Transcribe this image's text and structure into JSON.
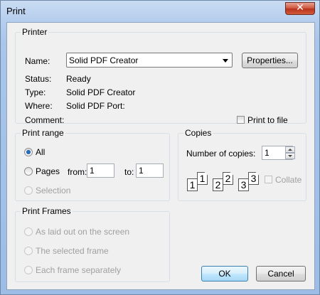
{
  "window": {
    "title": "Print",
    "close_glyph": "✕"
  },
  "printer": {
    "group_label": "Printer",
    "name_label": "Name:",
    "name_value": "Solid PDF Creator",
    "properties_button": "Properties...",
    "status_label": "Status:",
    "status_value": "Ready",
    "type_label": "Type:",
    "type_value": "Solid PDF Creator",
    "where_label": "Where:",
    "where_value": "Solid PDF Port:",
    "comment_label": "Comment:",
    "comment_value": "",
    "print_to_file": {
      "label": "Print to file",
      "checked": false
    }
  },
  "print_range": {
    "group_label": "Print range",
    "all_label": "All",
    "all_selected": true,
    "pages_label": "Pages",
    "from_label": "from:",
    "from_value": "1",
    "to_label": "to:",
    "to_value": "1",
    "selection_label": "Selection"
  },
  "copies": {
    "group_label": "Copies",
    "number_label": "Number of copies:",
    "number_value": "1",
    "collate": {
      "label": "Collate",
      "checked": false
    },
    "collate_pages": [
      "1",
      "1",
      "2",
      "2",
      "3",
      "3"
    ]
  },
  "print_frames": {
    "group_label": "Print Frames",
    "options": [
      "As laid out on the screen",
      "The selected frame",
      "Each frame separately"
    ]
  },
  "buttons": {
    "ok": "OK",
    "cancel": "Cancel"
  }
}
